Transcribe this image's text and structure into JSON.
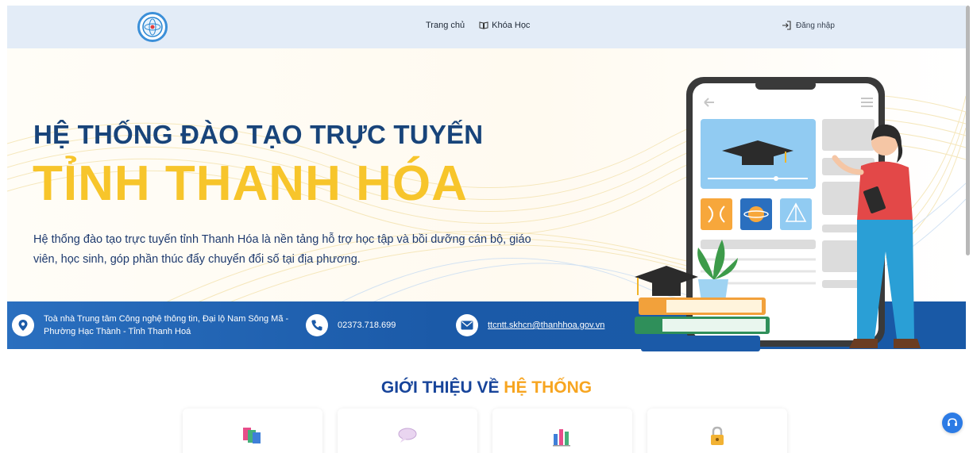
{
  "header": {
    "nav": [
      {
        "label": "Trang chủ",
        "icon": "home"
      },
      {
        "label": "Khóa Học",
        "icon": "book-icon"
      }
    ],
    "login_label": "Đăng nhập"
  },
  "hero": {
    "title_line1": "HỆ THỐNG ĐÀO TẠO TRỰC TUYẾN",
    "title_line2": "TỈNH THANH HÓA",
    "description": "Hệ thống đào tạo trực tuyến tỉnh Thanh Hóa là nền tảng hỗ trợ học tập và bồi dưỡng cán bộ, giáo viên, học sinh, góp phần thúc đẩy chuyển đổi số tại địa phương."
  },
  "contact": {
    "address": "Toà nhà Trung tâm Công nghệ thông tin, Đại lộ Nam Sông Mã - Phường Hạc Thành - Tỉnh Thanh Hoá",
    "phone": "02373.718.699",
    "email": "ttcntt.skhcn@thanhhoa.gov.vn"
  },
  "intro": {
    "title_main": "GIỚI THIỆU VỀ ",
    "title_accent": "HỆ THỐNG",
    "cards": [
      {
        "icon": "books-icon"
      },
      {
        "icon": "chat-bubble-icon"
      },
      {
        "icon": "bar-chart-icon"
      },
      {
        "icon": "lock-icon"
      }
    ]
  },
  "colors": {
    "header_bg": "#e3ecf7",
    "title_blue": "#18447a",
    "title_yellow": "#f7c52b",
    "contact_bar": "#1b5aa8",
    "accent_orange": "#f7a520",
    "support_button": "#2c7be5"
  }
}
